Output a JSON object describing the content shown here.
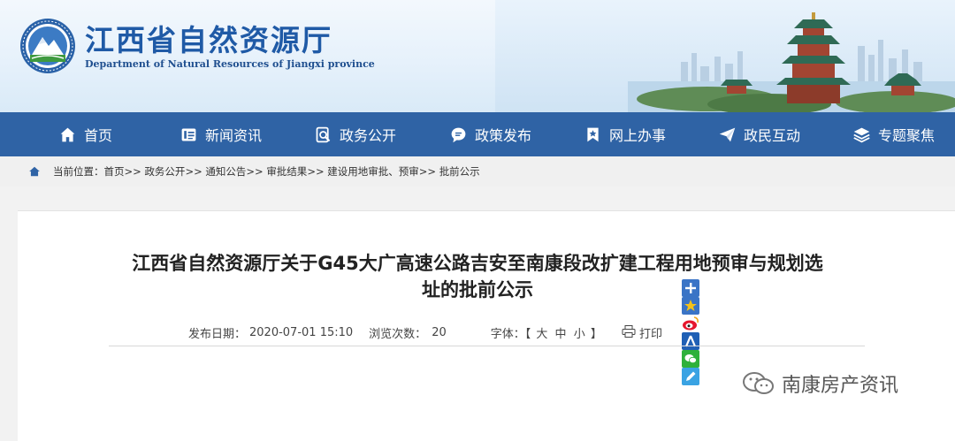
{
  "header": {
    "title": "江西省自然资源厅",
    "subtitle": "Department of Natural Resources of Jiangxi province"
  },
  "nav": [
    {
      "label": "首页",
      "icon": "home-icon"
    },
    {
      "label": "新闻资讯",
      "icon": "news-icon"
    },
    {
      "label": "政务公开",
      "icon": "search-doc-icon"
    },
    {
      "label": "政策发布",
      "icon": "chat-bubble-icon"
    },
    {
      "label": "网上办事",
      "icon": "bookmark-icon"
    },
    {
      "label": "政民互动",
      "icon": "paper-plane-icon"
    },
    {
      "label": "专题聚焦",
      "icon": "layers-icon"
    }
  ],
  "breadcrumb": {
    "prefix": "当前位置：",
    "items": [
      "首页",
      "政务公开",
      "通知公告",
      "审批结果",
      "建设用地审批、预审",
      "批前公示"
    ],
    "separator": ">>"
  },
  "article": {
    "title_line1": "江西省自然资源厅关于G45大广高速公路吉安至南康段改扩建工程用地预审与规划选",
    "title_line2": "址的批前公示",
    "date_label": "发布日期：",
    "date": "2020-07-01 15:10",
    "views_label": "浏览次数：",
    "views": "20",
    "font_label": "字体：【",
    "font_big": "大",
    "font_mid": "中",
    "font_small": "小",
    "font_end": "】",
    "print_label": "打印"
  },
  "watermark": "南康房产资讯",
  "colors": {
    "nav_bg": "#2f63a5",
    "title_blue": "#1f5aa6"
  }
}
